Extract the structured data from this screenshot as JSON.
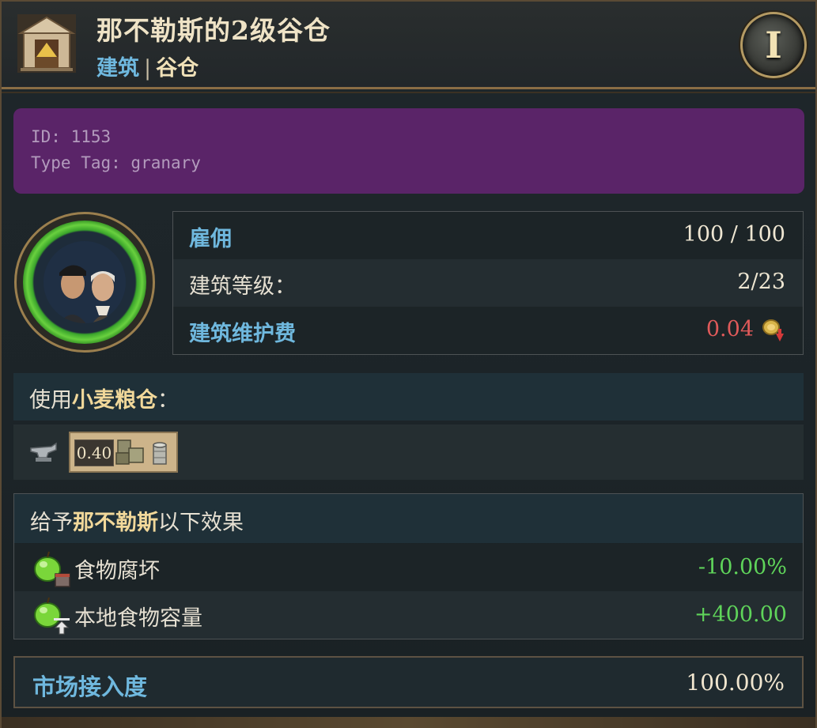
{
  "header": {
    "title": "那不勒斯的2级谷仓",
    "category_link": "建筑",
    "separator": "|",
    "type_label": "谷仓",
    "building_icon": "granary-building-icon",
    "info_button_label": "I"
  },
  "debug": {
    "id_line": "ID: 1153",
    "type_tag_line": "Type Tag: granary"
  },
  "portrait": {
    "icon": "workers-portrait-icon"
  },
  "stats": [
    {
      "label": "雇佣",
      "value": "100 / 100"
    },
    {
      "label": "建筑等级：",
      "value": "2/23"
    },
    {
      "label": "建筑维护费",
      "value": "0.04",
      "icon": "gold-coin-down-icon"
    }
  ],
  "uses": {
    "prefix": "使用",
    "good": "小麦粮仓",
    "suffix": "：",
    "item_value": "0.40",
    "tool_icon": "anvil-icon",
    "good_icon": "goods-crates-icon",
    "stack_icon": "coin-stack-icon"
  },
  "effects": {
    "head_prefix": "给予",
    "head_city": "那不勒斯",
    "head_suffix": "以下效果",
    "rows": [
      {
        "label": "食物腐坏",
        "value": "-10.00%",
        "icon": "apple-calendar-icon"
      },
      {
        "label": "本地食物容量",
        "value": "+400.00",
        "icon": "apple-capacity-icon"
      }
    ]
  },
  "market": {
    "label": "市场接入度",
    "value": "100.00%"
  },
  "colors": {
    "link_blue": "#6fb8de",
    "positive_green": "#5fd45a",
    "negative_red": "#e05a5a",
    "debug_purple": "#5a2468"
  }
}
